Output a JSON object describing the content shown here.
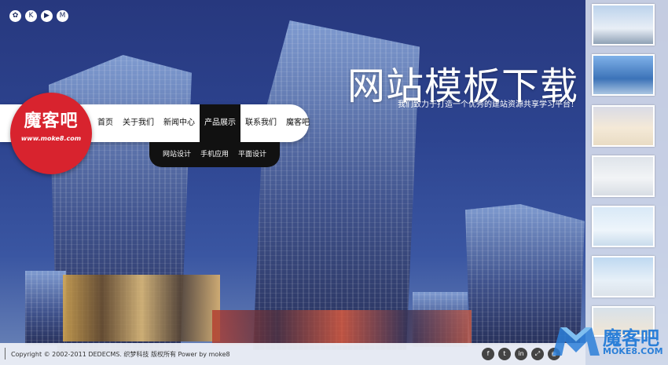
{
  "social_top": [
    "weibo-icon",
    "k-icon",
    "play-icon",
    "m-icon"
  ],
  "social_top_glyphs": [
    "✿",
    "K",
    "▶",
    "M"
  ],
  "banner": {
    "headline": "网站模板下载",
    "subline": "我们致力于打造一个优秀的建站资源共享学习平台！"
  },
  "logo": {
    "title": "魔客吧",
    "url": "www.moke8.com"
  },
  "nav": {
    "items": [
      "首页",
      "关于我们",
      "新闻中心",
      "产品展示",
      "联系我们",
      "魔客吧"
    ],
    "active_index": 3,
    "submenu": [
      "网站设计",
      "手机应用",
      "平面设计"
    ]
  },
  "footer": {
    "copyright": "Copyright © 2002-2011 DEDECMS. 织梦科技 版权所有 Power by moke8",
    "icons": [
      "facebook-icon",
      "twitter-icon",
      "linkedin-icon",
      "share-icon",
      "rss-icon"
    ],
    "icon_glyphs": [
      "f",
      "t",
      "in",
      "⤢",
      "◉"
    ]
  },
  "watermark": {
    "text": "魔客吧",
    "url": "MOKE8.COM"
  },
  "colors": {
    "accent_red": "#d8232e",
    "nav_active": "#111111",
    "watermark_blue": "#2b7fd8"
  }
}
